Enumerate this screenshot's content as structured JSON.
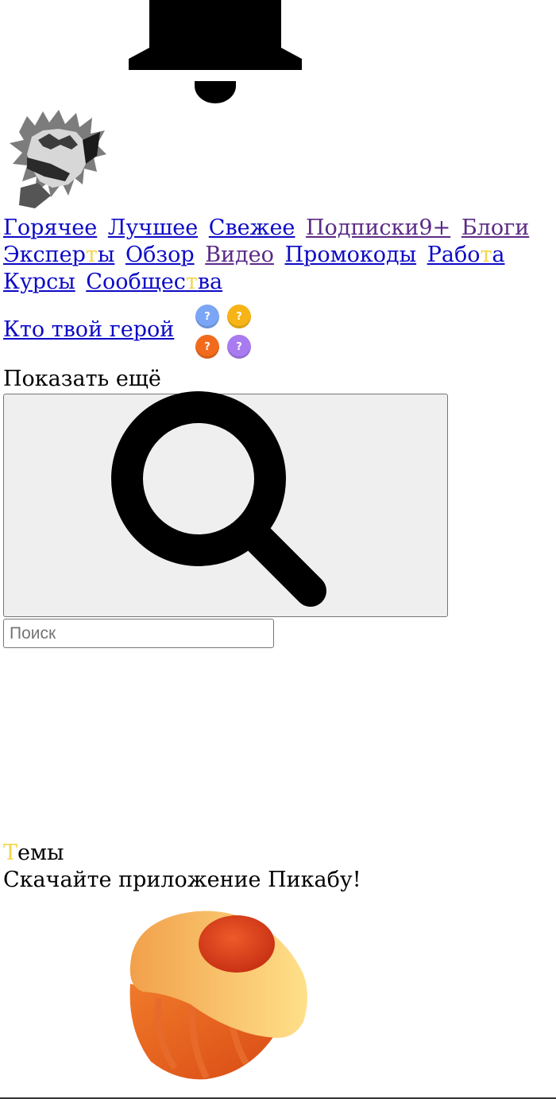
{
  "nav": {
    "items": [
      {
        "label": "Горячее"
      },
      {
        "label": "Лучшее"
      },
      {
        "label": "Свежее"
      },
      {
        "label": "Подписки9+"
      },
      {
        "label": "Блоги"
      },
      {
        "label_a": "Экспер",
        "label_hl": "т",
        "label_b": "ы"
      },
      {
        "label": "Обзор"
      },
      {
        "label": "Видео"
      },
      {
        "label": "Промокоды"
      },
      {
        "label_a": "Рабо",
        "label_hl": "т",
        "label_b": "а"
      },
      {
        "label": "Курсы"
      },
      {
        "label_a": "Сообщес",
        "label_hl": "т",
        "label_b": "ва"
      }
    ]
  },
  "hero": {
    "link_label": "Кто твой герой",
    "badges": [
      "?",
      "?",
      "?",
      "?"
    ]
  },
  "show_more_label": "Показать ещё",
  "search": {
    "placeholder": "Поиск"
  },
  "themes": {
    "label_hl": "Т",
    "label_rest": "емы"
  },
  "app_promo_text": "Скачайте приложение Пикабу!",
  "colors": {
    "link": "#0d0ac6",
    "visited_link": "#5b2a86",
    "highlight": "#f2d64e",
    "badge_blue": "#7aa6f5",
    "badge_yellow": "#f7b416",
    "badge_orange": "#f26b1d",
    "badge_purple": "#a97bf0"
  },
  "icons": [
    "bell-icon",
    "avatar",
    "search-icon",
    "pikabu-cupcake-logo"
  ]
}
